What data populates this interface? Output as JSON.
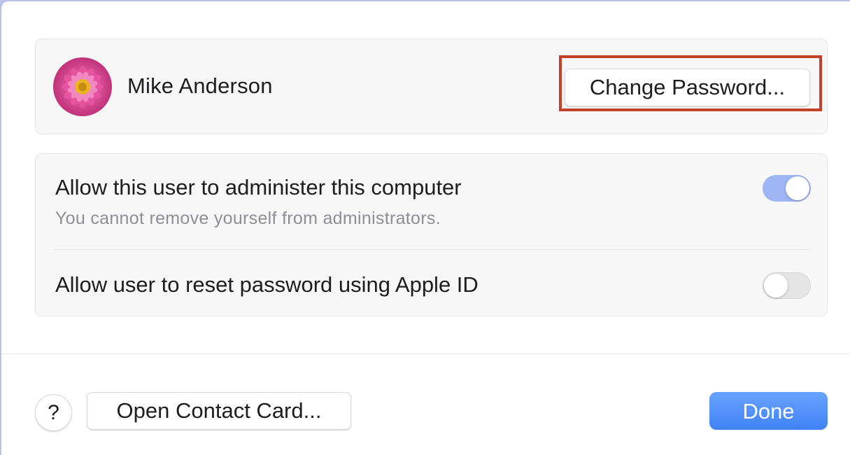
{
  "user": {
    "name": "Mike Anderson",
    "avatar_icon": "pink-flower-avatar"
  },
  "change_password_label": "Change Password...",
  "highlight_color": "#c2412a",
  "options": [
    {
      "title": "Allow this user to administer this computer",
      "subtitle": "You cannot remove yourself from administrators.",
      "enabled": true
    },
    {
      "title": "Allow user to reset password using Apple ID",
      "enabled": false
    }
  ],
  "footer": {
    "help_label": "?",
    "contact_card_label": "Open Contact Card...",
    "done_label": "Done"
  },
  "colors": {
    "accent": "#3f82f5",
    "toggle_on": "#9db5f2"
  }
}
